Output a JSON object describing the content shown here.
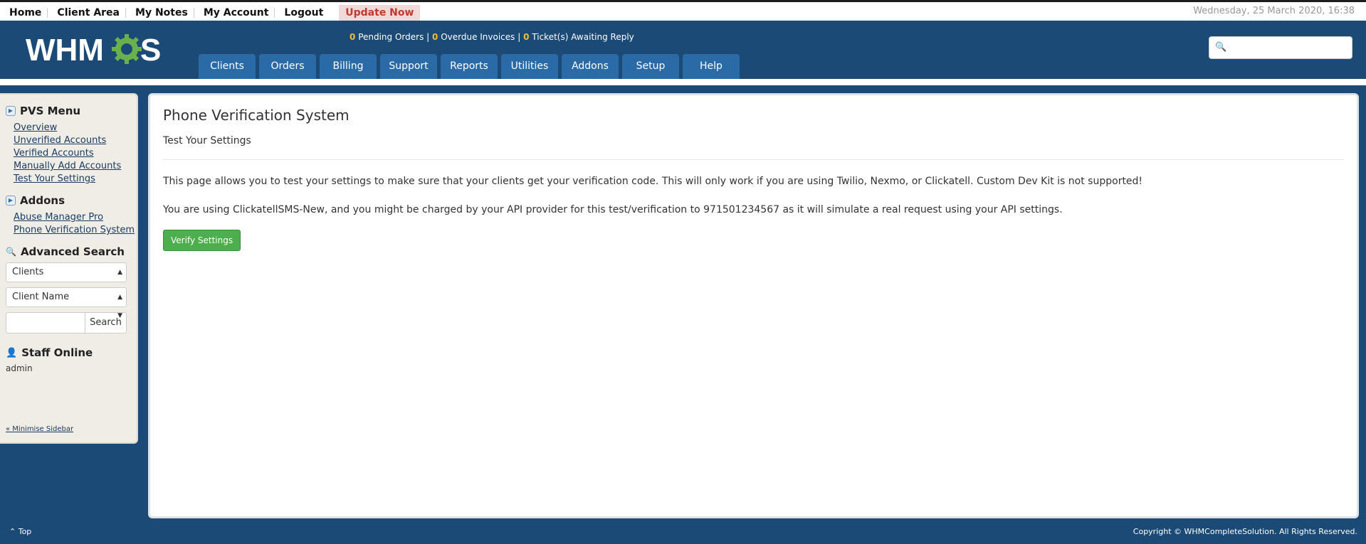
{
  "topbar": {
    "links": [
      "Home",
      "Client Area",
      "My Notes",
      "My Account",
      "Logout"
    ],
    "update_label": "Update Now",
    "date": "Wednesday, 25 March 2020, 16:38"
  },
  "header": {
    "logo_text_left": "WHM",
    "logo_text_right": "S",
    "stats": {
      "pending_orders_count": "0",
      "pending_orders_label": "Pending Orders",
      "overdue_invoices_count": "0",
      "overdue_invoices_label": "Overdue Invoices",
      "tickets_count": "0",
      "tickets_label": "Ticket(s) Awaiting Reply"
    },
    "nav": [
      "Clients",
      "Orders",
      "Billing",
      "Support",
      "Reports",
      "Utilities",
      "Addons",
      "Setup",
      "Help"
    ]
  },
  "sidebar": {
    "pvs_title": "PVS Menu",
    "pvs_items": [
      "Overview",
      "Unverified Accounts",
      "Verified Accounts",
      "Manually Add Accounts",
      "Test Your Settings"
    ],
    "addons_title": "Addons",
    "addons_items": [
      "Abuse Manager Pro",
      "Phone Verification System"
    ],
    "adv_search_title": "Advanced Search",
    "select_type": "Clients",
    "select_field": "Client Name",
    "search_button": "Search",
    "staff_title": "Staff Online",
    "staff_name": "admin",
    "minimise": "« Minimise Sidebar"
  },
  "main": {
    "title": "Phone Verification System",
    "subtitle": "Test Your Settings",
    "para1": "This page allows you to test your settings to make sure that your clients get your verification code. This will only work if you are using Twilio, Nexmo, or Clickatell. Custom Dev Kit is not supported!",
    "para2": "You are using ClickatellSMS-New, and you might be charged by your API provider for this test/verification to 971501234567 as it will simulate a real request using your API settings.",
    "verify_button": "Verify Settings"
  },
  "footer": {
    "top": "Top",
    "copyright": "Copyright © WHMCompleteSolution. All Rights Reserved."
  },
  "colors": {
    "header_bg": "#1a4a75",
    "nav_tab_bg": "#2a6aa7",
    "stat_number": "#f7b93e",
    "verify_button": "#4cae4c",
    "update_bg": "#f2d9d9",
    "update_text": "#c0392b"
  }
}
